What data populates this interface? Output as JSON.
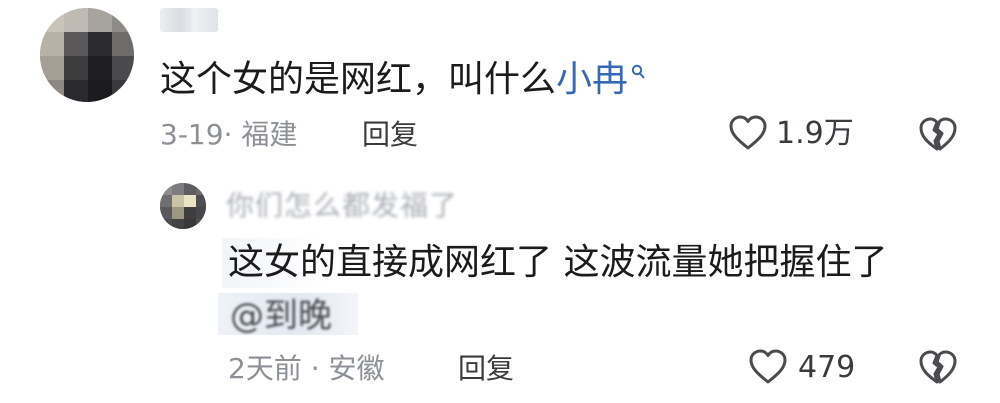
{
  "comment": {
    "text": "这个女的是网红，叫什么",
    "link_text": "小冉",
    "date": "3-19",
    "location": "福建",
    "reply_label": "回复",
    "like_count": "1.9万"
  },
  "reply": {
    "author": "你们怎么都发福了",
    "text": "这女的直接成网红了 这波流量她把握住了",
    "mention": "@到晚",
    "date": "2天前",
    "location": "安徽",
    "reply_label": "回复",
    "like_count": "479"
  },
  "icons": {
    "like": "heart-outline-icon",
    "dislike": "broken-heart-icon",
    "search": "search-small-icon"
  },
  "colors": {
    "link": "#3768b8",
    "meta": "#8d9096",
    "text": "#1b1b1b"
  }
}
